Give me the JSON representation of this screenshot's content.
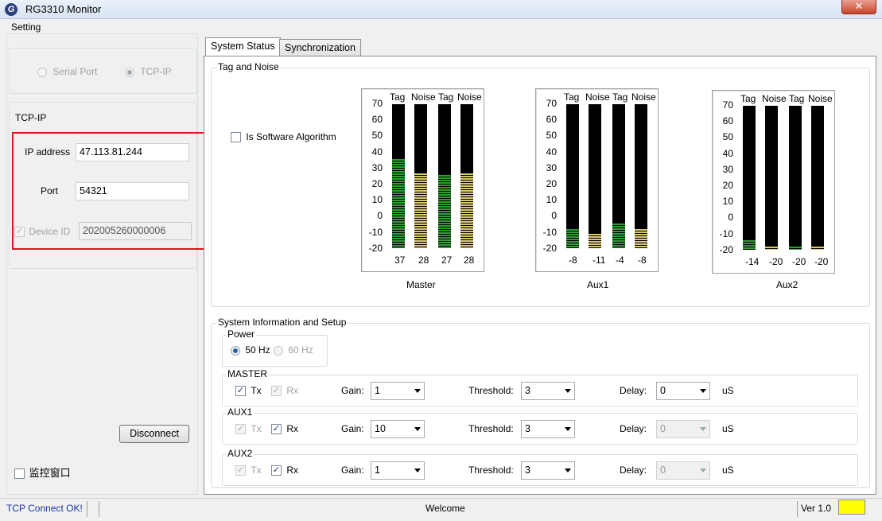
{
  "window": {
    "title": "RG3310 Monitor",
    "app_icon": "G",
    "close_symbol": "✕"
  },
  "setting": {
    "title": "Setting",
    "connection": {
      "serial_label": "Serial Port",
      "tcpip_label": "TCP-IP",
      "selected": "TCP-IP"
    },
    "tcpip": {
      "title": "TCP-IP",
      "ip_label": "IP address",
      "ip_value": "47.113.81.244",
      "port_label": "Port",
      "port_value": "54321",
      "device_id_label": "Device ID",
      "device_id_value": "202005260000006",
      "device_id_checked": true
    },
    "disconnect_label": "Disconnect",
    "monitor_window_label": "监控窗口",
    "highlight_color": "#d9181e"
  },
  "tabs": [
    {
      "label": "System Status",
      "active": true
    },
    {
      "label": "Synchronization",
      "active": false
    }
  ],
  "tag_noise": {
    "title": "Tag and Noise",
    "software_algorithm_label": "Is Software Algorithm",
    "ticks": [
      "70",
      "60",
      "50",
      "40",
      "30",
      "20",
      "10",
      "0",
      "-10",
      "-20"
    ],
    "meters": [
      {
        "name": "Master",
        "headers": [
          "Tag",
          "Noise",
          "Tag",
          "Noise"
        ],
        "values": [
          "37",
          "28",
          "27",
          "28"
        ]
      },
      {
        "name": "Aux1",
        "headers": [
          "Tag",
          "Noise",
          "Tag",
          "Noise"
        ],
        "values": [
          "-8",
          "-11",
          "-4",
          "-8"
        ]
      },
      {
        "name": "Aux2",
        "headers": [
          "Tag",
          "Noise",
          "Tag",
          "Noise"
        ],
        "values": [
          "-14",
          "-20",
          "-20",
          "-20"
        ]
      }
    ],
    "colors": {
      "tag": "#2e9e33",
      "noise": "#d8c870",
      "empty": "#000000"
    }
  },
  "sysinfo": {
    "title": "System Information and Setup",
    "power": {
      "title": "Power",
      "opt1": "50 Hz",
      "opt2": "60 Hz",
      "selected": "50 Hz"
    },
    "rows": [
      {
        "title": "MASTER",
        "tx": "Tx",
        "rx": "Rx",
        "gain_label": "Gain:",
        "gain": "1",
        "threshold_label": "Threshold:",
        "threshold": "3",
        "delay_label": "Delay:",
        "delay": "0",
        "unit": "uS"
      },
      {
        "title": "AUX1",
        "tx": "Tx",
        "rx": "Rx",
        "gain_label": "Gain:",
        "gain": "10",
        "threshold_label": "Threshold:",
        "threshold": "3",
        "delay_label": "Delay:",
        "delay": "0",
        "unit": "uS"
      },
      {
        "title": "AUX2",
        "tx": "Tx",
        "rx": "Rx",
        "gain_label": "Gain:",
        "gain": "1",
        "threshold_label": "Threshold:",
        "threshold": "3",
        "delay_label": "Delay:",
        "delay": "0",
        "unit": "uS"
      }
    ]
  },
  "status": {
    "connection": "TCP Connect OK!",
    "message": "Welcome",
    "version": "Ver 1.0",
    "indicator_color": "#ffff00"
  }
}
